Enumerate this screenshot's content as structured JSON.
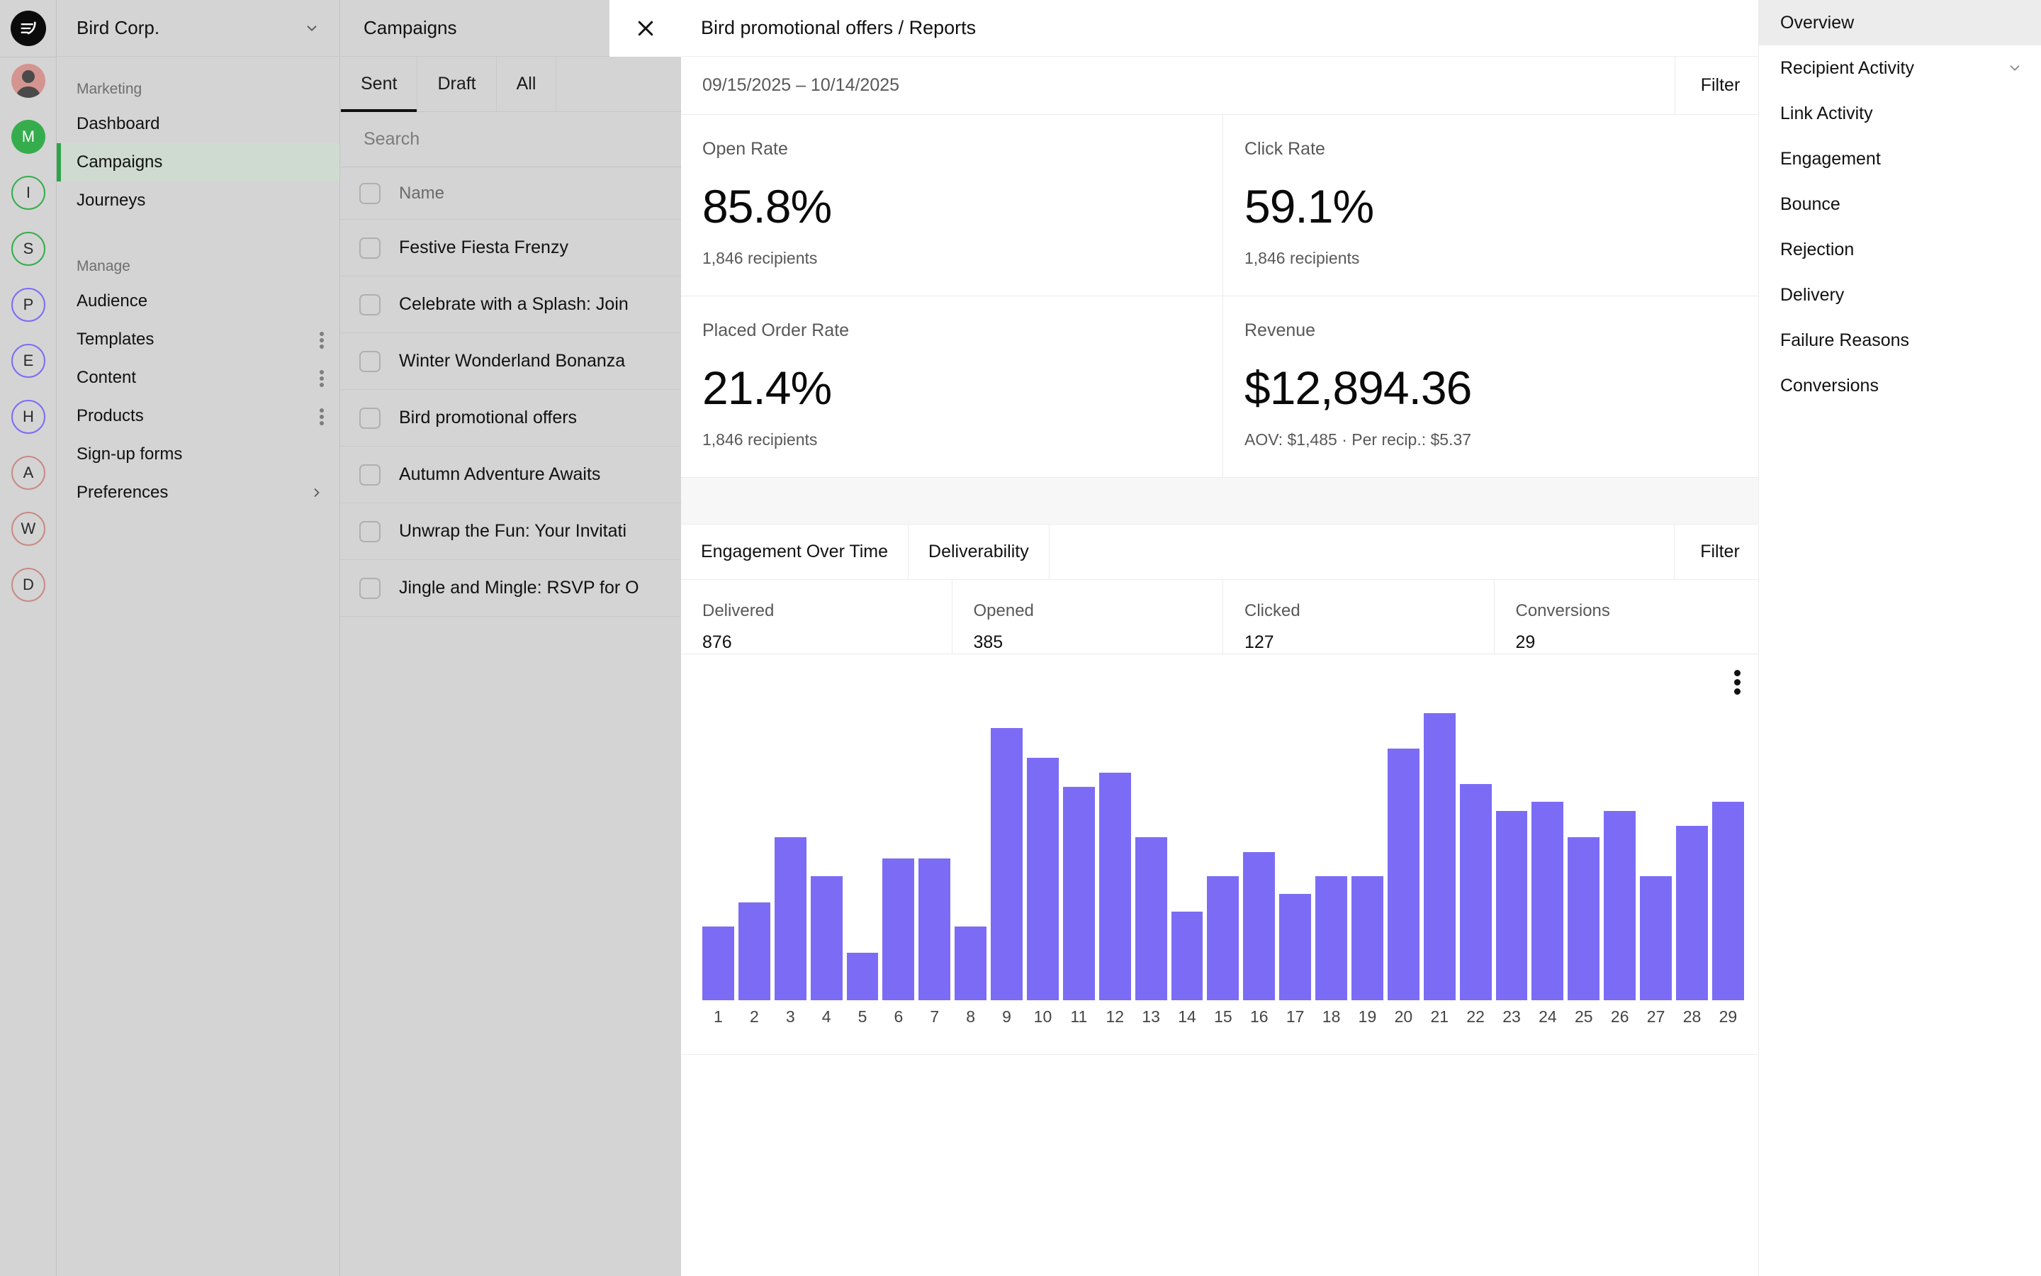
{
  "rail": {
    "logo_icon": "bird-logo-icon",
    "avatars": [
      {
        "name": "user-avatar",
        "type": "photo",
        "letter": "",
        "color": "#d4948f"
      },
      {
        "name": "workspace-avatar-m",
        "type": "filled",
        "letter": "M",
        "color": "#35ad4c"
      },
      {
        "name": "workspace-avatar-i",
        "type": "outline",
        "letter": "I",
        "color": "#35ad4c"
      },
      {
        "name": "workspace-avatar-s",
        "type": "outline",
        "letter": "S",
        "color": "#35ad4c"
      },
      {
        "name": "workspace-avatar-p",
        "type": "outline",
        "letter": "P",
        "color": "#7c6cf5"
      },
      {
        "name": "workspace-avatar-e",
        "type": "outline",
        "letter": "E",
        "color": "#7c6cf5"
      },
      {
        "name": "workspace-avatar-h",
        "type": "outline",
        "letter": "H",
        "color": "#7c6cf5"
      },
      {
        "name": "workspace-avatar-a",
        "type": "outline",
        "letter": "A",
        "color": "#c98a85"
      },
      {
        "name": "workspace-avatar-w",
        "type": "outline",
        "letter": "W",
        "color": "#c98a85"
      },
      {
        "name": "workspace-avatar-d",
        "type": "outline",
        "letter": "D",
        "color": "#c98a85"
      }
    ]
  },
  "sidebar": {
    "workspace": "Bird Corp.",
    "workspace_chevron_icon": "chevron-down-icon",
    "section_marketing": "Marketing",
    "section_manage": "Manage",
    "marketing_items": [
      {
        "label": "Dashboard",
        "active": false,
        "menu": false,
        "chevron": false
      },
      {
        "label": "Campaigns",
        "active": true,
        "menu": false,
        "chevron": false
      },
      {
        "label": "Journeys",
        "active": false,
        "menu": false,
        "chevron": false
      }
    ],
    "manage_items": [
      {
        "label": "Audience",
        "active": false,
        "menu": false,
        "chevron": false
      },
      {
        "label": "Templates",
        "active": false,
        "menu": true,
        "chevron": false
      },
      {
        "label": "Content",
        "active": false,
        "menu": true,
        "chevron": false
      },
      {
        "label": "Products",
        "active": false,
        "menu": true,
        "chevron": false
      },
      {
        "label": "Sign-up forms",
        "active": false,
        "menu": false,
        "chevron": false
      },
      {
        "label": "Preferences",
        "active": false,
        "menu": false,
        "chevron": true
      }
    ]
  },
  "campaigns": {
    "title": "Campaigns",
    "close_icon": "close-icon",
    "tabs": [
      {
        "label": "Sent",
        "selected": true
      },
      {
        "label": "Draft",
        "selected": false
      },
      {
        "label": "All",
        "selected": false
      }
    ],
    "search_placeholder": "Search",
    "column_header": "Name",
    "rows": [
      {
        "name": "Festive Fiesta Frenzy"
      },
      {
        "name": "Celebrate with a Splash: Join"
      },
      {
        "name": "Winter Wonderland Bonanza"
      },
      {
        "name": "Bird promotional offers"
      },
      {
        "name": "Autumn Adventure Awaits"
      },
      {
        "name": "Unwrap the Fun: Your Invitati"
      },
      {
        "name": "Jingle and Mingle: RSVP for O"
      }
    ]
  },
  "report": {
    "title": "Bird promotional offers / Reports",
    "date_range": "09/15/2025 – 10/14/2025",
    "filter_label": "Filter",
    "kpis": [
      {
        "label": "Open Rate",
        "value": "85.8%",
        "sub": "1,846 recipients"
      },
      {
        "label": "Click Rate",
        "value": "59.1%",
        "sub": "1,846 recipients"
      },
      {
        "label": "Placed Order Rate",
        "value": "21.4%",
        "sub": "1,846 recipients"
      },
      {
        "label": "Revenue",
        "value": "$12,894.36",
        "sub": "AOV: $1,485 · Per recip.: $5.37"
      }
    ],
    "chart_tabs": [
      {
        "label": "Engagement Over Time",
        "selected": true
      },
      {
        "label": "Deliverability",
        "selected": false
      }
    ],
    "chart_filter_label": "Filter",
    "stats": [
      {
        "label": "Delivered",
        "value": "876"
      },
      {
        "label": "Opened",
        "value": "385"
      },
      {
        "label": "Clicked",
        "value": "127"
      },
      {
        "label": "Conversions",
        "value": "29"
      }
    ],
    "chart_menu_icon": "more-vertical-icon"
  },
  "right_nav": {
    "items": [
      {
        "label": "Overview",
        "active": true,
        "chevron": false
      },
      {
        "label": "Recipient Activity",
        "active": false,
        "chevron": true
      },
      {
        "label": "Link Activity",
        "active": false,
        "chevron": false
      },
      {
        "label": "Engagement",
        "active": false,
        "chevron": false
      },
      {
        "label": "Bounce",
        "active": false,
        "chevron": false
      },
      {
        "label": "Rejection",
        "active": false,
        "chevron": false
      },
      {
        "label": "Delivery",
        "active": false,
        "chevron": false
      },
      {
        "label": "Failure Reasons",
        "active": false,
        "chevron": false
      },
      {
        "label": "Conversions",
        "active": false,
        "chevron": false
      }
    ]
  },
  "colors": {
    "bar": "#7c6cf5",
    "accent_green": "#2fa34a",
    "panel_bg": "#d4d4d4",
    "report_bg": "#ffffff"
  },
  "chart_data": {
    "type": "bar",
    "title": "Engagement Over Time",
    "xlabel": "",
    "ylabel": "",
    "grid": false,
    "legend": null,
    "ylim": [
      0,
      100
    ],
    "categories": [
      "1",
      "2",
      "3",
      "4",
      "5",
      "6",
      "7",
      "8",
      "9",
      "10",
      "11",
      "12",
      "13",
      "14",
      "15",
      "16",
      "17",
      "18",
      "19",
      "20",
      "21",
      "22",
      "23",
      "24",
      "25",
      "26",
      "27",
      "28",
      "29"
    ],
    "values": [
      25,
      33,
      55,
      42,
      16,
      48,
      48,
      25,
      92,
      82,
      72,
      77,
      55,
      30,
      42,
      50,
      36,
      42,
      42,
      85,
      97,
      73,
      64,
      67,
      55,
      64,
      42,
      59,
      67
    ]
  }
}
